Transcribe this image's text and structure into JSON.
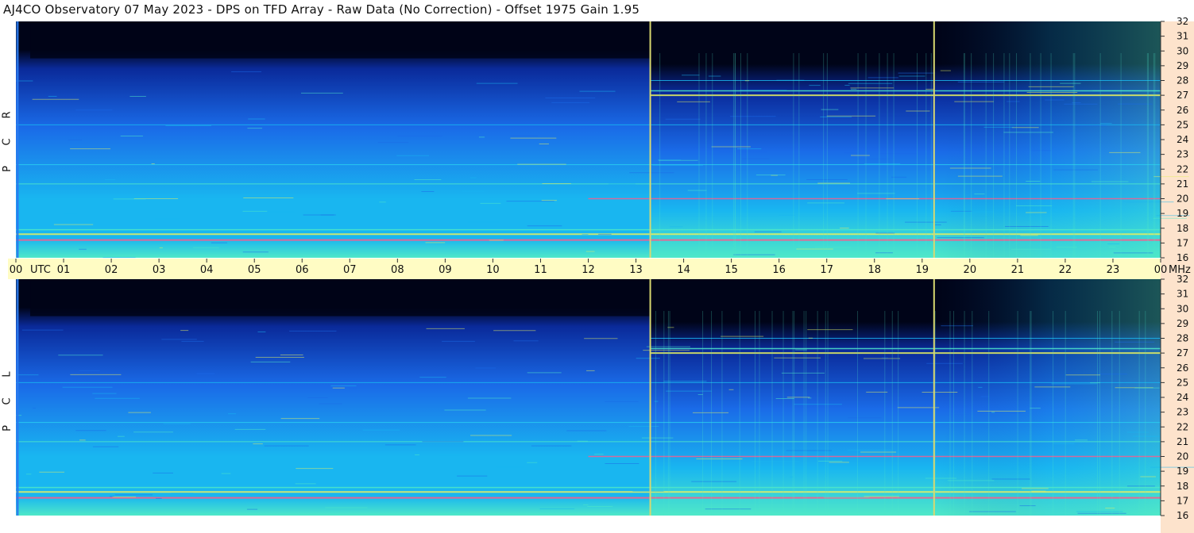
{
  "title": "AJ4CO Observatory  07 May 2023  -  DPS on TFD Array  -  Raw Data (No Correction)  -  Offset 1975  Gain 1.95",
  "panel_top_label": [
    "R",
    "C",
    "P"
  ],
  "panel_bottom_label": [
    "L",
    "C",
    "P"
  ],
  "chart_data": {
    "type": "heatmap",
    "title": "AJ4CO Observatory  07 May 2023  -  DPS on TFD Array  -  Raw Data (No Correction)  -  Offset 1975  Gain 1.95",
    "x_tick_labels": [
      "00",
      "01",
      "02",
      "03",
      "04",
      "05",
      "06",
      "07",
      "08",
      "09",
      "10",
      "11",
      "12",
      "13",
      "14",
      "15",
      "16",
      "17",
      "18",
      "19",
      "20",
      "21",
      "22",
      "23",
      "00"
    ],
    "x_axis_label_left": "UTC",
    "x_axis_label_right": "MHz",
    "xlim": [
      0,
      24
    ],
    "y_tick_labels": [
      "16",
      "17",
      "18",
      "19",
      "20",
      "21",
      "22",
      "23",
      "24",
      "25",
      "26",
      "27",
      "28",
      "29",
      "30",
      "31",
      "32"
    ],
    "ylim": [
      16,
      32
    ],
    "panels": [
      "RCP",
      "LCP"
    ],
    "marker_times_utc": [
      13.3,
      19.25
    ],
    "colormap": [
      "#000418",
      "#0a2a9a",
      "#1a6be8",
      "#19b6f0",
      "#4fe8c8",
      "#e6f060",
      "#ff5a8a"
    ]
  }
}
